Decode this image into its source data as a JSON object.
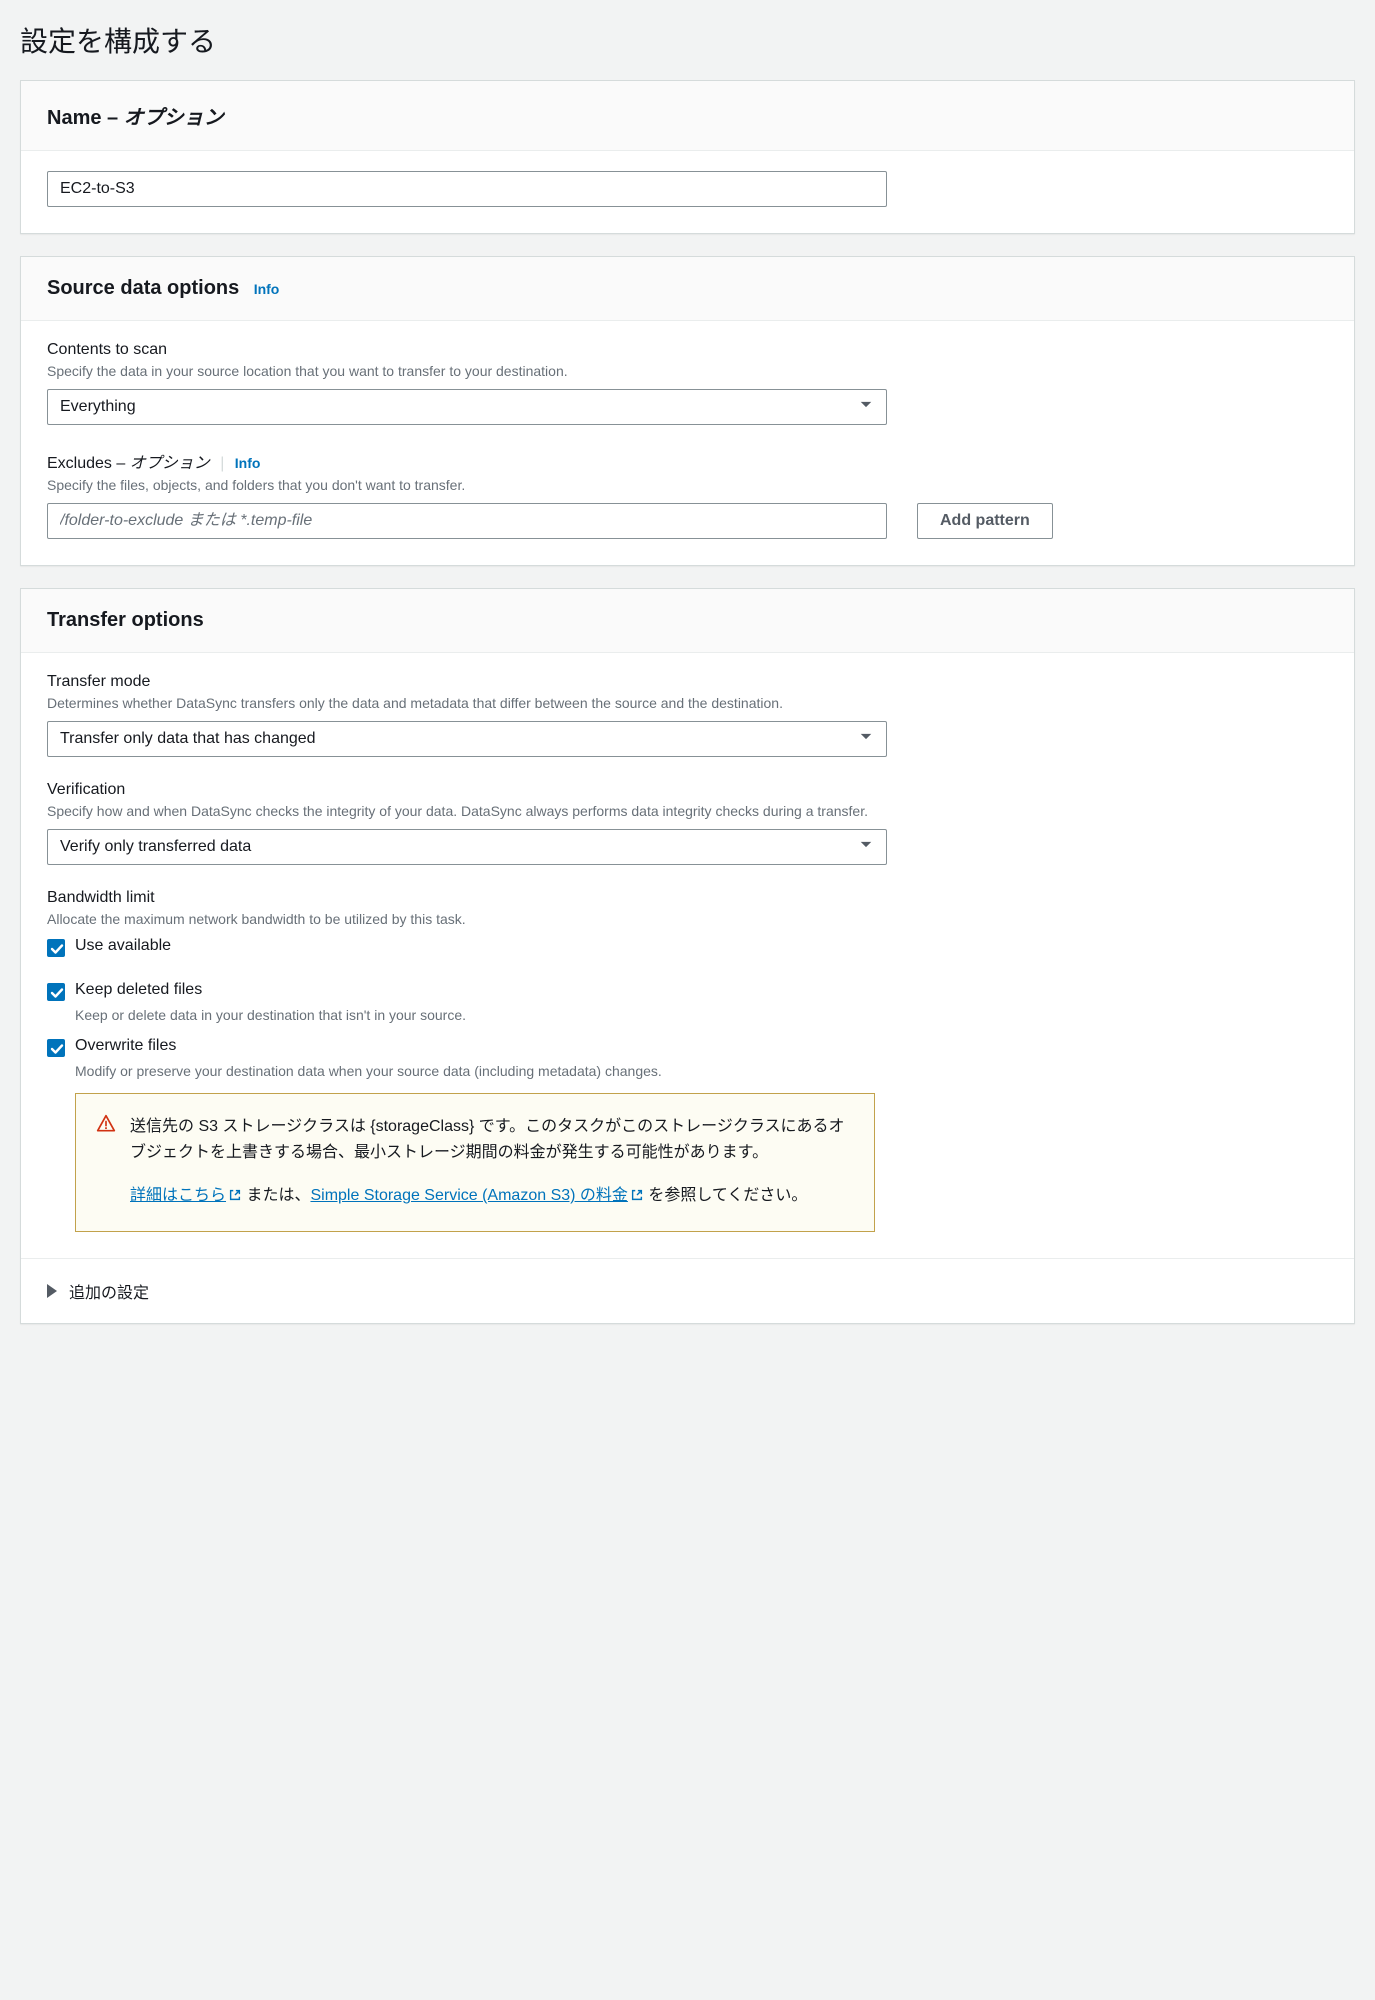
{
  "page": {
    "title": "設定を構成する"
  },
  "name_section": {
    "title_prefix": "Name – ",
    "title_optional": "オプション",
    "value": "EC2-to-S3"
  },
  "source_section": {
    "title": "Source data options",
    "info": "Info",
    "contents": {
      "label": "Contents to scan",
      "desc": "Specify the data in your source location that you want to transfer to your destination.",
      "value": "Everything"
    },
    "excludes": {
      "label_prefix": "Excludes – ",
      "label_optional": "オプション",
      "info": "Info",
      "desc": "Specify the files, objects, and folders that you don't want to transfer.",
      "placeholder": "/folder-to-exclude または *.temp-file",
      "add_button": "Add pattern"
    }
  },
  "transfer_section": {
    "title": "Transfer options",
    "mode": {
      "label": "Transfer mode",
      "desc": "Determines whether DataSync transfers only the data and metadata that differ between the source and the destination.",
      "value": "Transfer only data that has changed"
    },
    "verification": {
      "label": "Verification",
      "desc": "Specify how and when DataSync checks the integrity of your data. DataSync always performs data integrity checks during a transfer.",
      "value": "Verify only transferred data"
    },
    "bandwidth": {
      "label": "Bandwidth limit",
      "desc": "Allocate the maximum network bandwidth to be utilized by this task.",
      "use_available": "Use available"
    },
    "keep_deleted": {
      "label": "Keep deleted files",
      "desc": "Keep or delete data in your destination that isn't in your source."
    },
    "overwrite": {
      "label": "Overwrite files",
      "desc": "Modify or preserve your destination data when your source data (including metadata) changes."
    },
    "alert": {
      "body": "送信先の S3 ストレージクラスは {storageClass} です。このタスクがこのストレージクラスにあるオブジェクトを上書きする場合、最小ストレージ期間の料金が発生する可能性があります。",
      "link1": "詳細はこちら",
      "between": " または、",
      "link2": "Simple Storage Service (Amazon S3) の料金",
      "after": " を参照してください。"
    },
    "expand": "追加の設定"
  }
}
